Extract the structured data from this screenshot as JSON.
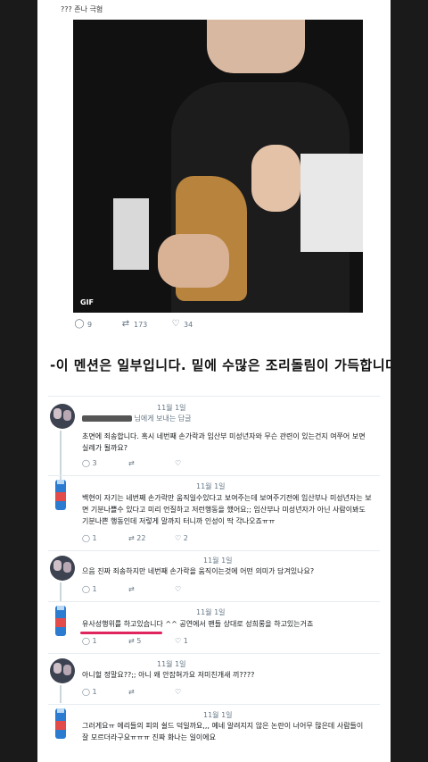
{
  "top_caption": "??? 존나 극혐",
  "gif_badge": "GIF",
  "tweet_stats": {
    "replies": "9",
    "retweets": "173",
    "likes": "34"
  },
  "headline": "-이 멘션은 일부입니다. 밑에 수많은 조리돌림이 가득합니다.",
  "comments": [
    {
      "date": "11월 1일",
      "meta": "님에게 보내는 답글",
      "text": "초면에 죄송합니다. 혹시 네번째 손가락과 임산부 미성년자와 무슨 관련이 있는건지 여쭈어 보면 실례가 될까요?",
      "replies": "3",
      "retweets": "",
      "likes": ""
    },
    {
      "date": "11월 1일",
      "text": "백현이 자기는 네번째 손가락만 움직일수있다고 보여주는데 보여주기전에 임산부나 미성년자는 보면 기분나쁠수 있다고 미리 언질하고 저런행동을 했어요;; 임산부나 미성년자가 아닌 사람이봐도 기분나쁜 행동인데 저렇게 말까지 터니까 인성이 딱 각나오죠ㅠㅠ",
      "replies": "1",
      "retweets": "22",
      "likes": "2"
    },
    {
      "date": "11월 1일",
      "text": "으음 진짜 죄송하지만 네번째 손가락을 움직이는것에 어떤 의미가 담겨있나요?",
      "replies": "1",
      "retweets": "",
      "likes": ""
    },
    {
      "date": "11월 1일",
      "text": "유사성행위를 하고있습니다 ^^ 공연에서 팬들 상대로 성희롱을 하고있는거죠",
      "replies": "1",
      "retweets": "5",
      "likes": "1"
    },
    {
      "date": "11월 1일",
      "text": "아니헐 정말요??;; 아니 왜 안잡혀가요 저미친개새 끼????",
      "replies": "1",
      "retweets": "",
      "likes": ""
    },
    {
      "date": "11월 1일",
      "text": "그러게요ㅠ 에리들의 피의 쉴드 덕일까요,,, 예네 알려지지 않은 논란이 너어무 많은데 사람들이 잘 모르더라구요ㅠㅠㅠ 진짜 화나는 일이에요",
      "replies": "",
      "retweets": "",
      "likes": ""
    }
  ],
  "icons": {
    "reply": "reply-icon",
    "retweet": "retweet-icon",
    "like": "like-icon"
  }
}
